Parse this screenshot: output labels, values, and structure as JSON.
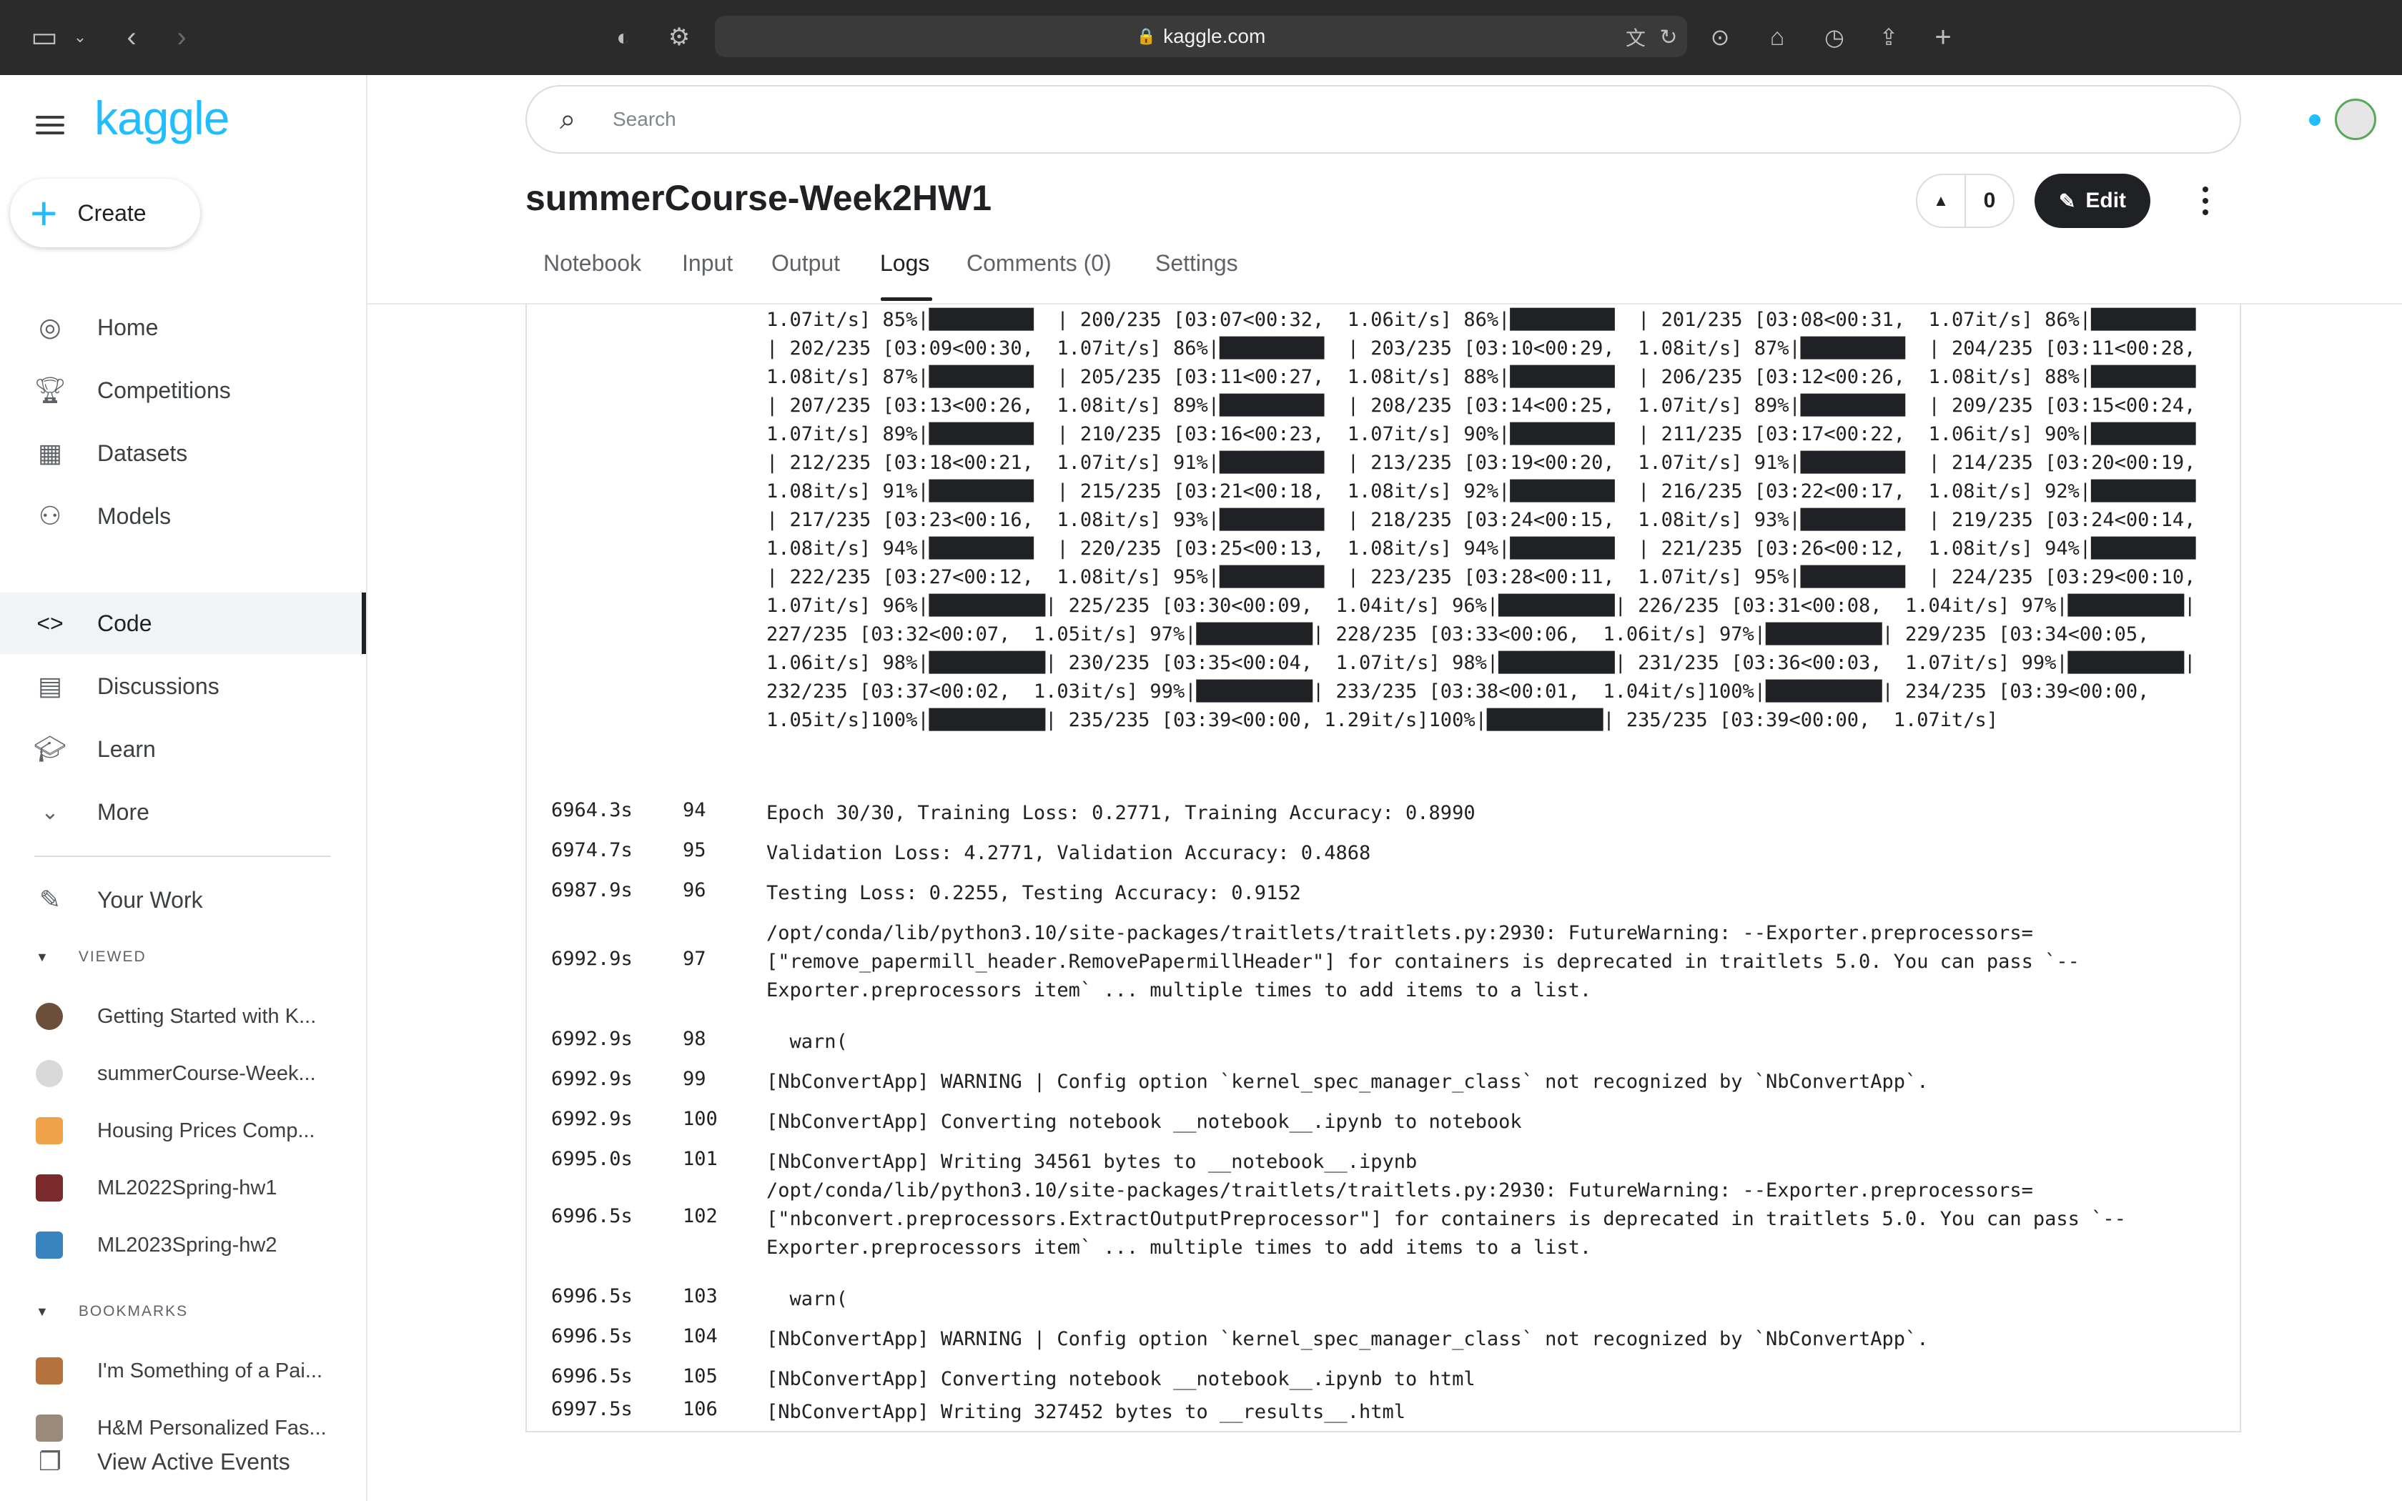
{
  "browser": {
    "url": "kaggle.com"
  },
  "sidebar": {
    "logo": "kaggle",
    "create_label": "Create",
    "nav": [
      {
        "label": "Home",
        "icon": "compass-icon"
      },
      {
        "label": "Competitions",
        "icon": "trophy-icon"
      },
      {
        "label": "Datasets",
        "icon": "table-icon"
      },
      {
        "label": "Models",
        "icon": "models-icon"
      },
      {
        "label": "Code",
        "icon": "code-icon",
        "active": true
      },
      {
        "label": "Discussions",
        "icon": "chat-icon"
      },
      {
        "label": "Learn",
        "icon": "graduation-cap-icon"
      },
      {
        "label": "More",
        "icon": "chevron-down-icon"
      }
    ],
    "your_work": "Your Work",
    "viewed_header": "VIEWED",
    "viewed": [
      {
        "label": "Getting Started with K..."
      },
      {
        "label": "summerCourse-Week..."
      },
      {
        "label": "Housing Prices Comp..."
      },
      {
        "label": "ML2022Spring-hw1"
      },
      {
        "label": "ML2023Spring-hw2"
      }
    ],
    "bookmarks_header": "BOOKMARKS",
    "bookmarks": [
      {
        "label": "I'm Something of a Pai..."
      },
      {
        "label": "H&M Personalized Fas..."
      }
    ],
    "view_active_events": "View Active Events"
  },
  "header": {
    "search_placeholder": "Search",
    "title": "summerCourse-Week2HW1",
    "vote_count": "0",
    "edit_label": "Edit"
  },
  "tabs": [
    "Notebook",
    "Input",
    "Output",
    "Logs",
    "Comments (0)",
    "Settings"
  ],
  "active_tab": "Logs",
  "logs": {
    "progress_text": "1.07it/s] 85%|█████████  | 200/235 [03:07<00:32,  1.06it/s] 86%|█████████  | 201/235 [03:08<00:31,  1.07it/s] 86%|█████████  | 202/235 [03:09<00:30,  1.07it/s] 86%|█████████  | 203/235 [03:10<00:29,  1.08it/s] 87%|█████████  | 204/235 [03:11<00:28,  1.08it/s] 87%|█████████  | 205/235 [03:11<00:27,  1.08it/s] 88%|█████████  | 206/235 [03:12<00:26,  1.08it/s] 88%|█████████  | 207/235 [03:13<00:26,  1.08it/s] 89%|█████████  | 208/235 [03:14<00:25,  1.07it/s] 89%|█████████  | 209/235 [03:15<00:24,  1.07it/s] 89%|█████████  | 210/235 [03:16<00:23,  1.07it/s] 90%|█████████  | 211/235 [03:17<00:22,  1.06it/s] 90%|█████████  | 212/235 [03:18<00:21,  1.07it/s] 91%|█████████  | 213/235 [03:19<00:20,  1.07it/s] 91%|█████████  | 214/235 [03:20<00:19,  1.08it/s] 91%|█████████  | 215/235 [03:21<00:18,  1.08it/s] 92%|█████████  | 216/235 [03:22<00:17,  1.08it/s] 92%|█████████  | 217/235 [03:23<00:16,  1.08it/s] 93%|█████████  | 218/235 [03:24<00:15,  1.08it/s] 93%|█████████  | 219/235 [03:24<00:14,  1.08it/s] 94%|█████████  | 220/235 [03:25<00:13,  1.08it/s] 94%|█████████  | 221/235 [03:26<00:12,  1.08it/s] 94%|█████████  | 222/235 [03:27<00:12,  1.08it/s] 95%|█████████  | 223/235 [03:28<00:11,  1.07it/s] 95%|█████████  | 224/235 [03:29<00:10,  1.07it/s] 96%|██████████| 225/235 [03:30<00:09,  1.04it/s] 96%|██████████| 226/235 [03:31<00:08,  1.04it/s] 97%|██████████| 227/235 [03:32<00:07,  1.05it/s] 97%|██████████| 228/235 [03:33<00:06,  1.06it/s] 97%|██████████| 229/235 [03:34<00:05,  1.06it/s] 98%|██████████| 230/235 [03:35<00:04,  1.07it/s] 98%|██████████| 231/235 [03:36<00:03,  1.07it/s] 99%|██████████| 232/235 [03:37<00:02,  1.03it/s] 99%|██████████| 233/235 [03:38<00:01,  1.04it/s]100%|██████████| 234/235 [03:39<00:00,  1.05it/s]100%|██████████| 235/235 [03:39<00:00, 1.29it/s]100%|██████████| 235/235 [03:39<00:00,  1.07it/s]",
    "rows": [
      {
        "ts": "6964.3s",
        "line": "94",
        "msg": "Epoch 30/30, Training Loss: 0.2771, Training Accuracy: 0.8990"
      },
      {
        "ts": "6974.7s",
        "line": "95",
        "msg": "Validation Loss: 4.2771, Validation Accuracy: 0.4868"
      },
      {
        "ts": "6987.9s",
        "line": "96",
        "msg": "Testing Loss: 0.2255, Testing Accuracy: 0.9152"
      },
      {
        "ts": "6992.9s",
        "line": "97",
        "msg": "/opt/conda/lib/python3.10/site-packages/traitlets/traitlets.py:2930: FutureWarning: --Exporter.preprocessors=[\"remove_papermill_header.RemovePapermillHeader\"] for containers is deprecated in traitlets 5.0. You can pass `--Exporter.preprocessors item` ... multiple times to add items to a list."
      },
      {
        "ts": "6992.9s",
        "line": "98",
        "msg": "  warn("
      },
      {
        "ts": "6992.9s",
        "line": "99",
        "msg": "[NbConvertApp] WARNING | Config option `kernel_spec_manager_class` not recognized by `NbConvertApp`."
      },
      {
        "ts": "6992.9s",
        "line": "100",
        "msg": "[NbConvertApp] Converting notebook __notebook__.ipynb to notebook"
      },
      {
        "ts": "6995.0s",
        "line": "101",
        "msg": "[NbConvertApp] Writing 34561 bytes to __notebook__.ipynb"
      },
      {
        "ts": "6996.5s",
        "line": "102",
        "msg": "/opt/conda/lib/python3.10/site-packages/traitlets/traitlets.py:2930: FutureWarning: --Exporter.preprocessors=[\"nbconvert.preprocessors.ExtractOutputPreprocessor\"] for containers is deprecated in traitlets 5.0. You can pass `--Exporter.preprocessors item` ... multiple times to add items to a list."
      },
      {
        "ts": "6996.5s",
        "line": "103",
        "msg": "  warn("
      },
      {
        "ts": "6996.5s",
        "line": "104",
        "msg": "[NbConvertApp] WARNING | Config option `kernel_spec_manager_class` not recognized by `NbConvertApp`."
      },
      {
        "ts": "6996.5s",
        "line": "105",
        "msg": "[NbConvertApp] Converting notebook __notebook__.ipynb to html"
      },
      {
        "ts": "6997.5s",
        "line": "106",
        "msg": "[NbConvertApp] Writing 327452 bytes to __results__.html"
      }
    ]
  }
}
